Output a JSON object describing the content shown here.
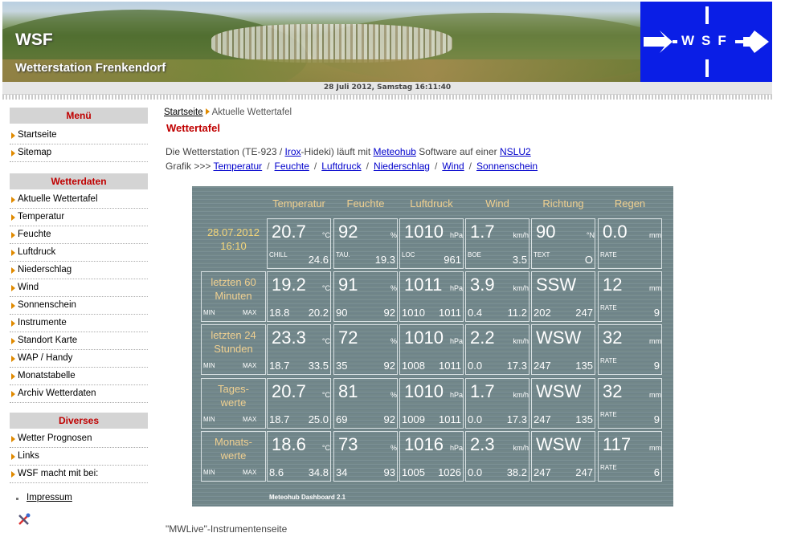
{
  "header": {
    "site_name": "WSF",
    "subtitle": "Wetterstation Frenkendorf",
    "logo_text": "WSF",
    "date": "28 Juli 2012, Samstag 16:11:40"
  },
  "sidebar": {
    "menu_title": "Menü",
    "menu": [
      "Startseite",
      "Sitemap"
    ],
    "wetter_title": "Wetterdaten",
    "wetter": [
      "Aktuelle Wettertafel",
      "Temperatur",
      "Feuchte",
      "Luftdruck",
      "Niederschlag",
      "Wind",
      "Sonnenschein",
      "Instrumente",
      "Standort Karte",
      "WAP / Handy",
      "Monatstabelle",
      "Archiv Wetterdaten"
    ],
    "div_title": "Diverses",
    "div": [
      "Wetter Prognosen",
      "Links",
      "WSF macht mit bei:"
    ],
    "impressum": "Impressum"
  },
  "breadcrumb": {
    "home": "Startseite",
    "current": "Aktuelle Wettertafel"
  },
  "main": {
    "title": "Wettertafel",
    "intro_1": "Die Wetterstation  (TE-923 / ",
    "intro_link_1": "Irox",
    "intro_2": "-Hideki) läuft mit ",
    "intro_link_2": "Meteohub",
    "intro_3": " Software auf einer ",
    "intro_link_3": "NSLU2",
    "grafik_label": "Grafik >>> ",
    "grafik_links": [
      "Temperatur",
      "Feuchte",
      "Luftdruck",
      "Niederschlag",
      "Wind",
      "Sonnenschein"
    ],
    "footer": "\"MWLive\"-Instrumentenseite"
  },
  "dashboard": {
    "headers": [
      "Temperatur",
      "Feuchte",
      "Luftdruck",
      "Wind",
      "Richtung",
      "Regen"
    ],
    "brand": "Meteohub Dashboard 2.1",
    "rows": [
      {
        "label1": "28.07.2012",
        "label2": "16:10",
        "min": "",
        "max": "",
        "temp": "20.7",
        "temp_u": "°C",
        "temp_l": "CHILL",
        "temp_r": "24.6",
        "hum": "92",
        "hum_u": "%",
        "hum_l": "TAU.",
        "hum_r": "19.3",
        "pres": "1010",
        "pres_u": "hPa",
        "pres_l": "LOC",
        "pres_r": "961",
        "wind": "1.7",
        "wind_u": "km/h",
        "wind_l": "BOE",
        "wind_r": "3.5",
        "dir": "90",
        "dir_u": "°N",
        "dir_l": "TEXT",
        "dir_r": "O",
        "rain": "0.0",
        "rain_u": "mm",
        "rain_l": "RATE",
        "rain_r": ""
      },
      {
        "label1": "letzten 60",
        "label2": "Minuten",
        "min": "MIN",
        "max": "MAX",
        "temp": "19.2",
        "temp_u": "°C",
        "temp_l": "18.8",
        "temp_r": "20.2",
        "hum": "91",
        "hum_u": "%",
        "hum_l": "90",
        "hum_r": "92",
        "pres": "1011",
        "pres_u": "hPa",
        "pres_l": "1010",
        "pres_r": "1011",
        "wind": "3.9",
        "wind_u": "km/h",
        "wind_l": "0.4",
        "wind_r": "11.2",
        "dir": "SSW",
        "dir_u": "",
        "dir_l": "202",
        "dir_r": "247",
        "rain": "12",
        "rain_u": "mm",
        "rain_l": "RATE",
        "rain_r": "9"
      },
      {
        "label1": "letzten 24",
        "label2": "Stunden",
        "min": "MIN",
        "max": "MAX",
        "temp": "23.3",
        "temp_u": "°C",
        "temp_l": "18.7",
        "temp_r": "33.5",
        "hum": "72",
        "hum_u": "%",
        "hum_l": "35",
        "hum_r": "92",
        "pres": "1010",
        "pres_u": "hPa",
        "pres_l": "1008",
        "pres_r": "1011",
        "wind": "2.2",
        "wind_u": "km/h",
        "wind_l": "0.0",
        "wind_r": "17.3",
        "dir": "WSW",
        "dir_u": "",
        "dir_l": "247",
        "dir_r": "135",
        "rain": "32",
        "rain_u": "mm",
        "rain_l": "RATE",
        "rain_r": "9"
      },
      {
        "label1": "Tages-",
        "label2": "werte",
        "min": "MIN",
        "max": "MAX",
        "temp": "20.7",
        "temp_u": "°C",
        "temp_l": "18.7",
        "temp_r": "25.0",
        "hum": "81",
        "hum_u": "%",
        "hum_l": "69",
        "hum_r": "92",
        "pres": "1010",
        "pres_u": "hPa",
        "pres_l": "1009",
        "pres_r": "1011",
        "wind": "1.7",
        "wind_u": "km/h",
        "wind_l": "0.0",
        "wind_r": "17.3",
        "dir": "WSW",
        "dir_u": "",
        "dir_l": "247",
        "dir_r": "135",
        "rain": "32",
        "rain_u": "mm",
        "rain_l": "RATE",
        "rain_r": "9"
      },
      {
        "label1": "Monats-",
        "label2": "werte",
        "min": "MIN",
        "max": "MAX",
        "temp": "18.6",
        "temp_u": "°C",
        "temp_l": "8.6",
        "temp_r": "34.8",
        "hum": "73",
        "hum_u": "%",
        "hum_l": "34",
        "hum_r": "93",
        "pres": "1016",
        "pres_u": "hPa",
        "pres_l": "1005",
        "pres_r": "1026",
        "wind": "2.3",
        "wind_u": "km/h",
        "wind_l": "0.0",
        "wind_r": "38.2",
        "dir": "WSW",
        "dir_u": "",
        "dir_l": "247",
        "dir_r": "247",
        "rain": "117",
        "rain_u": "mm",
        "rain_l": "RATE",
        "rain_r": "6"
      }
    ]
  },
  "colors": {
    "accent_red": "#c00000",
    "link_blue": "#0000cc",
    "logo_blue": "#0a1ee6",
    "arrow_orange": "#e08a00"
  }
}
